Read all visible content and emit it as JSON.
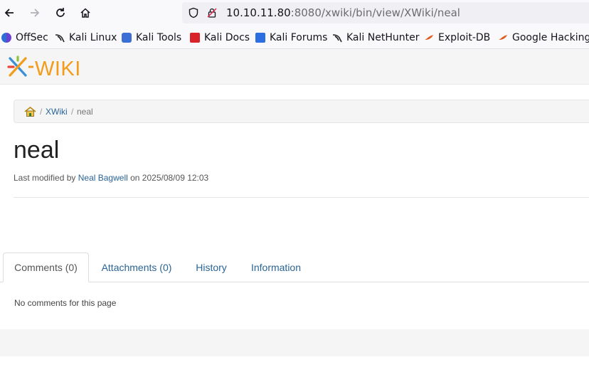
{
  "browser": {
    "url_host": "10.10.11.80",
    "url_rest": ":8080/xwiki/bin/view/XWiki/neal",
    "bookmarks": [
      {
        "label": "OffSec",
        "icon": "offsec-icon"
      },
      {
        "label": "Kali Linux",
        "icon": "kali-dragon-icon"
      },
      {
        "label": "Kali Tools",
        "icon": "kali-tools-icon"
      },
      {
        "label": "Kali Docs",
        "icon": "kali-docs-icon"
      },
      {
        "label": "Kali Forums",
        "icon": "kali-forums-icon"
      },
      {
        "label": "Kali NetHunter",
        "icon": "kali-dragon-icon"
      },
      {
        "label": "Exploit-DB",
        "icon": "exploitdb-icon"
      },
      {
        "label": "Google Hacking D",
        "icon": "exploitdb-icon"
      }
    ]
  },
  "xwiki": {
    "logo_text": "XWIKI"
  },
  "breadcrumb": {
    "items": [
      "XWiki",
      "neal"
    ],
    "separator": "/"
  },
  "page": {
    "title": "neal",
    "last_modified_prefix": "Last modified by",
    "author": "Neal Bagwell",
    "date_text": "on 2025/08/09 12:03"
  },
  "tabs": [
    {
      "label": "Comments (0)",
      "active": true
    },
    {
      "label": "Attachments (0)",
      "active": false
    },
    {
      "label": "History",
      "active": false
    },
    {
      "label": "Information",
      "active": false
    }
  ],
  "comments": {
    "empty_text": "No comments for this page"
  },
  "colors": {
    "link": "#2a6496",
    "logo_orange": "#f29c1b",
    "logo_blue": "#3a8fd6"
  }
}
